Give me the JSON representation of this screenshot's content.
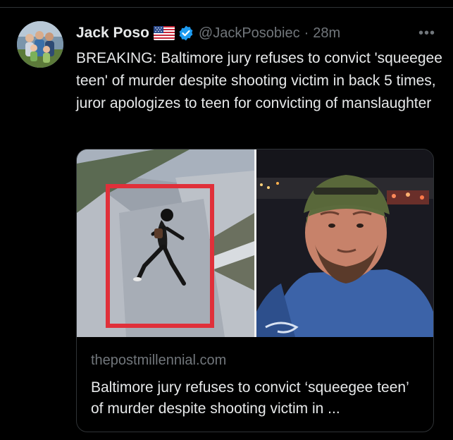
{
  "tweet": {
    "author_name": "Jack Poso",
    "flag_icon": "us-flag-icon",
    "verified_icon": "verified-badge-icon",
    "handle": "@JackPosobiec",
    "separator": "·",
    "time": "28m",
    "more_label": "•••",
    "text": "BREAKING: Baltimore jury refuses to convict 'squeegee teen' of murder despite shooting victim in back 5 times, juror apologizes to teen for convicting of manslaughter"
  },
  "card": {
    "domain": "thepostmillennial.com",
    "title": "Baltimore jury refuses to convict ‘squeegee teen’ of murder despite shooting victim in ..."
  },
  "colors": {
    "background": "#000000",
    "text": "#e7e9ea",
    "secondary": "#71767b",
    "border": "#2f3336",
    "verified": "#1d9bf0",
    "highlight_box": "#e0303a"
  }
}
